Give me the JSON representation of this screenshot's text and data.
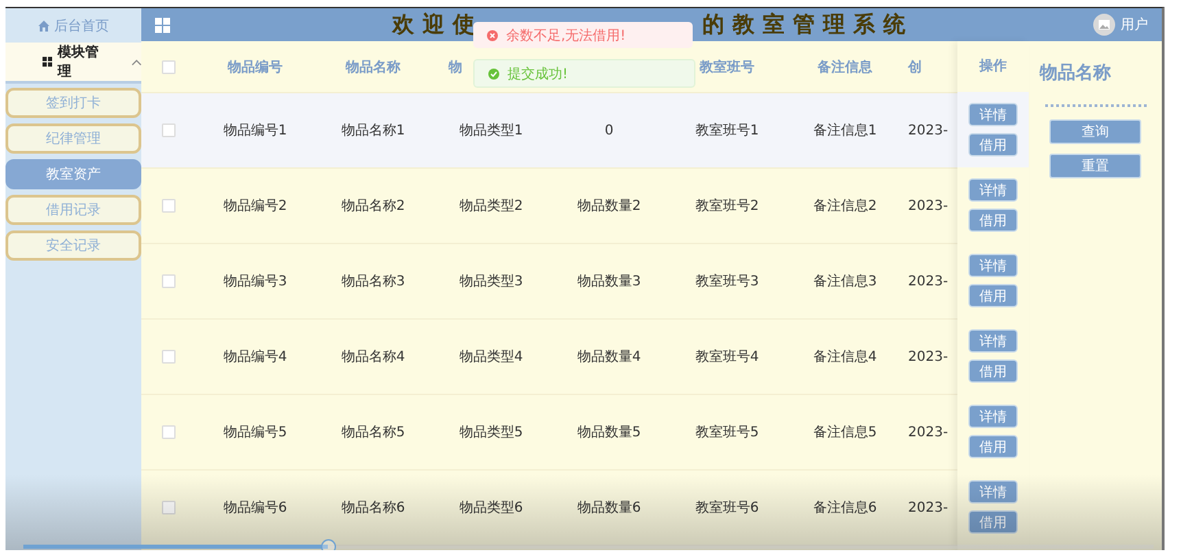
{
  "sidebar": {
    "home": {
      "label": "后台首页"
    },
    "group": {
      "label": "模块管理",
      "expanded": true,
      "items": [
        {
          "label": "签到打卡",
          "selected": false
        },
        {
          "label": "纪律管理",
          "selected": false
        },
        {
          "label": "教室资产",
          "selected": true
        },
        {
          "label": "借用记录",
          "selected": false
        },
        {
          "label": "安全记录",
          "selected": false
        }
      ]
    }
  },
  "header": {
    "title_start": "欢迎使",
    "title_end": "的教室管理系统",
    "user": "用户"
  },
  "toasts": [
    {
      "kind": "error",
      "text": "余数不足,无法借用!"
    },
    {
      "kind": "success",
      "text": "提交成功!"
    }
  ],
  "table": {
    "select_all_checked": false,
    "columns": [
      "物品编号",
      "物品名称",
      "物",
      null,
      "教室班号",
      "备注信息",
      "创"
    ],
    "actions_label": "操作",
    "rows": [
      {
        "selected": true,
        "checked": false,
        "cells": [
          "物品编号1",
          "物品名称1",
          "物品类型1",
          "0",
          "教室班号1",
          "备注信息1",
          "2023-"
        ],
        "actions": [
          "详情",
          "借用"
        ]
      },
      {
        "selected": false,
        "checked": false,
        "cells": [
          "物品编号2",
          "物品名称2",
          "物品类型2",
          "物品数量2",
          "教室班号2",
          "备注信息2",
          "2023-"
        ],
        "actions": [
          "详情",
          "借用"
        ]
      },
      {
        "selected": false,
        "checked": false,
        "cells": [
          "物品编号3",
          "物品名称3",
          "物品类型3",
          "物品数量3",
          "教室班号3",
          "备注信息3",
          "2023-"
        ],
        "actions": [
          "详情",
          "借用"
        ]
      },
      {
        "selected": false,
        "checked": false,
        "cells": [
          "物品编号4",
          "物品名称4",
          "物品类型4",
          "物品数量4",
          "教室班号4",
          "备注信息4",
          "2023-"
        ],
        "actions": [
          "详情",
          "借用"
        ]
      },
      {
        "selected": false,
        "checked": false,
        "cells": [
          "物品编号5",
          "物品名称5",
          "物品类型5",
          "物品数量5",
          "教室班号5",
          "备注信息5",
          "2023-"
        ],
        "actions": [
          "详情",
          "借用"
        ]
      },
      {
        "selected": false,
        "checked": false,
        "cells": [
          "物品编号6",
          "物品名称6",
          "物品类型6",
          "物品数量6",
          "教室班号6",
          "备注信息6",
          "2023-"
        ],
        "actions": [
          "详情",
          "借用"
        ]
      }
    ]
  },
  "search_panel": {
    "title": "物品名称",
    "buttons": [
      "查询",
      "重置"
    ]
  },
  "player": {
    "level": 0.27
  }
}
